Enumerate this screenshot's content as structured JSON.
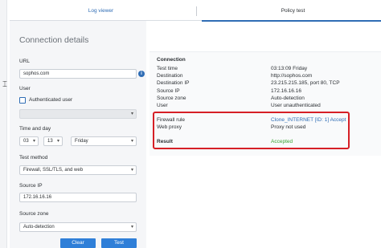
{
  "tabs": [
    {
      "label": "Log viewer",
      "active": false
    },
    {
      "label": "Policy test",
      "active": true
    }
  ],
  "form": {
    "title": "Connection details",
    "url_label": "URL",
    "url_value": "sophos.com",
    "user_label": "User",
    "authenticated_user_label": "Authenticated user",
    "authenticated_user_checked": false,
    "user_select_value": "",
    "time_label": "Time and day",
    "hour_value": "03",
    "minute_value": "13",
    "day_value": "Friday",
    "test_method_label": "Test method",
    "test_method_value": "Firewall, SSL/TLS, and web",
    "source_ip_label": "Source IP",
    "source_ip_value": "172.16.16.16",
    "source_zone_label": "Source zone",
    "source_zone_value": "Auto-detection",
    "clear_label": "Clear",
    "test_label": "Test"
  },
  "result": {
    "heading": "Connection",
    "rows": [
      {
        "label": "Test time",
        "value": "03:13:09 Friday"
      },
      {
        "label": "Destination",
        "value": "http://sophos.com"
      },
      {
        "label": "Destination IP",
        "value": "23.215.215.185, port 80, TCP"
      },
      {
        "label": "Source IP",
        "value": "172.16.16.16"
      },
      {
        "label": "Source zone",
        "value": "Auto-detection"
      },
      {
        "label": "User",
        "value": "User unauthenticated"
      }
    ],
    "firewall_rule_label": "Firewall rule",
    "firewall_rule_value": "Clone_INTERNET [ID: 1] Accept",
    "web_proxy_label": "Web proxy",
    "web_proxy_value": "Proxy not used",
    "result_label": "Result",
    "result_value": "Accepted"
  },
  "colors": {
    "accent": "#2f6db5",
    "button": "#2f7fd8",
    "highlight": "#d61f26",
    "success": "#3aa335"
  }
}
